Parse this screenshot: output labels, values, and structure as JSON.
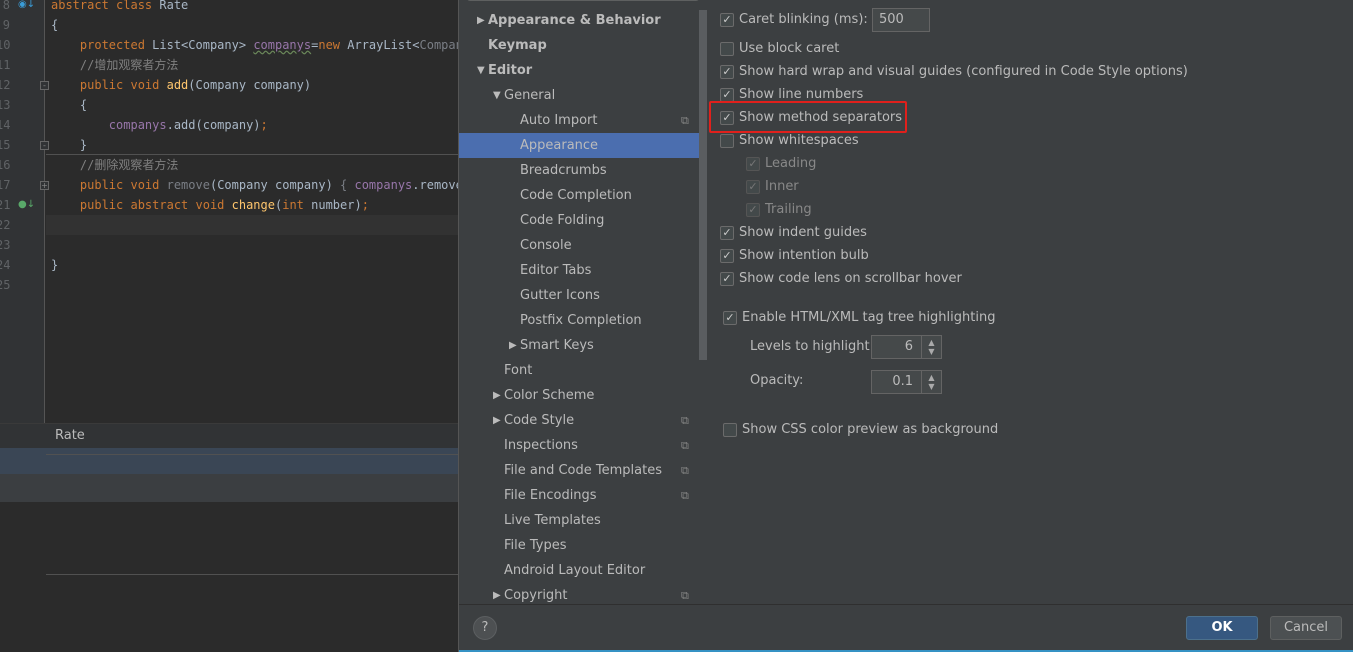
{
  "editor": {
    "lines": [
      {
        "n": "8",
        "icon": "o",
        "tokens": [
          [
            "kw",
            "abstract class "
          ],
          [
            "",
            "Rate"
          ]
        ]
      },
      {
        "n": "9",
        "tokens": [
          [
            "",
            "{"
          ]
        ]
      },
      {
        "n": "10",
        "tokens": [
          [
            "",
            "    "
          ],
          [
            "kw",
            "protected "
          ],
          [
            "",
            "List<Company> "
          ],
          [
            "fld bad",
            "companys"
          ],
          [
            "",
            "="
          ],
          [
            "kw",
            "new "
          ],
          [
            "",
            "ArrayList<"
          ],
          [
            "gr",
            "Company"
          ]
        ]
      },
      {
        "n": "11",
        "tokens": [
          [
            "",
            "    "
          ],
          [
            "cm",
            "//增加观察者方法"
          ]
        ]
      },
      {
        "n": "12",
        "fold": "-",
        "tokens": [
          [
            "",
            "    "
          ],
          [
            "kw",
            "public void "
          ],
          [
            "fn",
            "add"
          ],
          [
            "",
            "(Company company)"
          ]
        ]
      },
      {
        "n": "13",
        "tokens": [
          [
            "",
            "    {"
          ]
        ]
      },
      {
        "n": "14",
        "tokens": [
          [
            "",
            "        "
          ],
          [
            "fld",
            "companys"
          ],
          [
            "",
            ".add(company)"
          ],
          [
            "kw",
            ";"
          ]
        ]
      },
      {
        "n": "15",
        "fold": "-",
        "tokens": [
          [
            "",
            "    }"
          ]
        ]
      },
      {
        "n": "16",
        "tokens": [
          [
            "",
            "    "
          ],
          [
            "cm",
            "//删除观察者方法"
          ]
        ]
      },
      {
        "n": "17",
        "fold": "+",
        "tokens": [
          [
            "",
            "    "
          ],
          [
            "kw",
            "public void "
          ],
          [
            "gr",
            "remove"
          ],
          [
            "",
            "(Company company) "
          ],
          [
            "gr",
            "{ "
          ],
          [
            "fld",
            "companys"
          ],
          [
            "",
            ".remove("
          ]
        ]
      },
      {
        "n": "21",
        "icon": "i",
        "tokens": [
          [
            "",
            "    "
          ],
          [
            "kw",
            "public abstract void "
          ],
          [
            "fn",
            "change"
          ],
          [
            "",
            "("
          ],
          [
            "kw",
            "int "
          ],
          [
            "",
            "number)"
          ],
          [
            "kw",
            ";"
          ]
        ]
      },
      {
        "n": "22",
        "tokens": []
      },
      {
        "n": "23",
        "tokens": []
      },
      {
        "n": "24",
        "tokens": [
          [
            "",
            "}"
          ]
        ]
      },
      {
        "n": "25",
        "tokens": []
      }
    ],
    "structure_label": "Rate"
  },
  "tree": [
    {
      "label": "Appearance & Behavior",
      "level": 0,
      "arrow": "right",
      "bold": true
    },
    {
      "label": "Keymap",
      "level": 0,
      "bold": true
    },
    {
      "label": "Editor",
      "level": 0,
      "arrow": "down",
      "bold": true
    },
    {
      "label": "General",
      "level": 1,
      "arrow": "down"
    },
    {
      "label": "Auto Import",
      "level": 2,
      "copy": true
    },
    {
      "label": "Appearance",
      "level": 2,
      "selected": true
    },
    {
      "label": "Breadcrumbs",
      "level": 2
    },
    {
      "label": "Code Completion",
      "level": 2
    },
    {
      "label": "Code Folding",
      "level": 2
    },
    {
      "label": "Console",
      "level": 2
    },
    {
      "label": "Editor Tabs",
      "level": 2
    },
    {
      "label": "Gutter Icons",
      "level": 2
    },
    {
      "label": "Postfix Completion",
      "level": 2
    },
    {
      "label": "Smart Keys",
      "level": 2,
      "arrow": "right"
    },
    {
      "label": "Font",
      "level": 1
    },
    {
      "label": "Color Scheme",
      "level": 1,
      "arrow": "right"
    },
    {
      "label": "Code Style",
      "level": 1,
      "arrow": "right",
      "copy": true
    },
    {
      "label": "Inspections",
      "level": 1,
      "copy": true
    },
    {
      "label": "File and Code Templates",
      "level": 1,
      "copy": true
    },
    {
      "label": "File Encodings",
      "level": 1,
      "copy": true
    },
    {
      "label": "Live Templates",
      "level": 1
    },
    {
      "label": "File Types",
      "level": 1
    },
    {
      "label": "Android Layout Editor",
      "level": 1
    },
    {
      "label": "Copyright",
      "level": 1,
      "arrow": "right",
      "copy": true
    }
  ],
  "options": {
    "caret_blinking": {
      "label": "Caret blinking (ms):",
      "checked": true,
      "value": "500"
    },
    "items": [
      {
        "label": "Use block caret",
        "checked": false
      },
      {
        "label": "Show hard wrap and visual guides (configured in Code Style options)",
        "checked": true
      },
      {
        "label": "Show line numbers",
        "checked": true
      },
      {
        "label": "Show method separators",
        "checked": true,
        "highlighted": true
      },
      {
        "label": "Show whitespaces",
        "checked": false
      },
      {
        "label": "Leading",
        "checked": true,
        "disabled": true,
        "indent": true
      },
      {
        "label": "Inner",
        "checked": true,
        "disabled": true,
        "indent": true
      },
      {
        "label": "Trailing",
        "checked": true,
        "disabled": true,
        "indent": true
      },
      {
        "label": "Show indent guides",
        "checked": true
      },
      {
        "label": "Show intention bulb",
        "checked": true
      },
      {
        "label": "Show code lens on scrollbar hover",
        "checked": true
      }
    ],
    "tag_tree": {
      "label": "Enable HTML/XML tag tree highlighting",
      "checked": true
    },
    "levels": {
      "label": "Levels to highlight:",
      "value": "6"
    },
    "opacity": {
      "label": "Opacity:",
      "value": "0.1"
    },
    "css_preview": {
      "label": "Show CSS color preview as background",
      "checked": false
    }
  },
  "footer": {
    "help": "?",
    "ok": "OK",
    "cancel": "Cancel"
  },
  "colors": {
    "selection": "#4b6eaf",
    "highlight_box": "#e0201c",
    "ok_button": "#365880"
  }
}
